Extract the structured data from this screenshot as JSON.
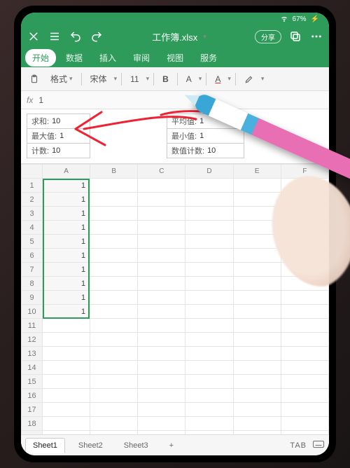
{
  "status": {
    "battery": "67%",
    "charging": "⚡"
  },
  "titlebar": {
    "filename": "工作簿.xlsx",
    "share": "分享"
  },
  "menu": {
    "tabs": [
      "开始",
      "数据",
      "插入",
      "审阅",
      "视图",
      "服务"
    ],
    "active": 0
  },
  "toolbar": {
    "format": "格式",
    "font": "宋体",
    "size": "11",
    "bold": "B",
    "fontA": "A",
    "underlineA": "A"
  },
  "formula": {
    "fx": "fx",
    "value": "1"
  },
  "stats": {
    "sum_label": "求和:",
    "sum": "10",
    "avg_label": "平均值:",
    "avg": "1",
    "max_label": "最大值:",
    "max": "1",
    "min_label": "最小值:",
    "min": "1",
    "count_label": "计数:",
    "count": "10",
    "numcount_label": "数值计数:",
    "numcount": "10"
  },
  "grid": {
    "cols": [
      "A",
      "B",
      "C",
      "D",
      "E",
      "F"
    ],
    "rows": 19,
    "data_rows": 10,
    "cell_value": "1"
  },
  "sheets": {
    "tabs": [
      "Sheet1",
      "Sheet2",
      "Sheet3"
    ],
    "active": 0,
    "add": "+",
    "tab_key": "TAB"
  }
}
